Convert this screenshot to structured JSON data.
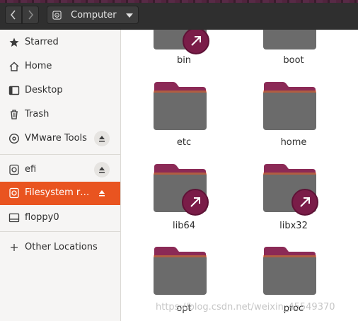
{
  "header": {
    "back_icon": "chevron-left-icon",
    "forward_icon": "chevron-right-icon",
    "path_label": "Computer",
    "path_icon": "drive-icon",
    "dropdown_icon": "caret-down-icon"
  },
  "sidebar": {
    "items": [
      {
        "label": "Starred",
        "icon": "star-icon"
      },
      {
        "label": "Home",
        "icon": "home-icon"
      },
      {
        "label": "Desktop",
        "icon": "desktop-icon"
      },
      {
        "label": "Trash",
        "icon": "trash-icon"
      },
      {
        "label": "VMware Tools",
        "icon": "disc-icon",
        "eject": true
      },
      {
        "label": "efi",
        "icon": "drive-icon",
        "eject": true
      },
      {
        "label": "Filesystem r…",
        "icon": "drive-icon",
        "eject": true,
        "active": true
      },
      {
        "label": "floppy0",
        "icon": "floppy-icon"
      },
      {
        "label": "Other Locations",
        "icon": "plus-icon"
      }
    ]
  },
  "folders": [
    {
      "name": "bin",
      "symlink": true
    },
    {
      "name": "boot",
      "symlink": false
    },
    {
      "name": "etc",
      "symlink": false
    },
    {
      "name": "home",
      "symlink": false
    },
    {
      "name": "lib64",
      "symlink": true
    },
    {
      "name": "libx32",
      "symlink": true
    },
    {
      "name": "opt",
      "symlink": false
    },
    {
      "name": "proc",
      "symlink": false
    }
  ],
  "watermark": "https://blog.csdn.net/weixin_45549370",
  "colors": {
    "accent": "#e95420",
    "folder_tab": "#8b2a56",
    "folder_body": "#6b6b6b",
    "symlink_badge": "#7a1c48",
    "headerbar": "#2f2f2f",
    "sidebar_bg": "#f6f5f4"
  }
}
